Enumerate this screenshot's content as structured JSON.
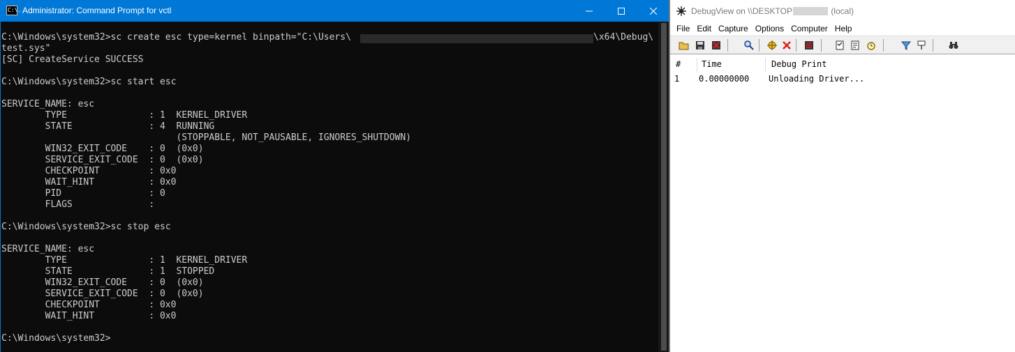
{
  "cmd_window": {
    "title": "Administrator: Command Prompt for vctl",
    "icon_label": "C:\\.",
    "lines": [
      "C:\\Windows\\system32>sc create esc type=kernel binpath=\"C:\\Users\\",
      "test.sys\"",
      "[SC] CreateService SUCCESS",
      "",
      "C:\\Windows\\system32>sc start esc",
      "",
      "SERVICE_NAME: esc",
      "        TYPE               : 1  KERNEL_DRIVER",
      "        STATE              : 4  RUNNING",
      "                                (STOPPABLE, NOT_PAUSABLE, IGNORES_SHUTDOWN)",
      "        WIN32_EXIT_CODE    : 0  (0x0)",
      "        SERVICE_EXIT_CODE  : 0  (0x0)",
      "        CHECKPOINT         : 0x0",
      "        WAIT_HINT          : 0x0",
      "        PID                : 0",
      "        FLAGS              :",
      "",
      "C:\\Windows\\system32>sc stop esc",
      "",
      "SERVICE_NAME: esc",
      "        TYPE               : 1  KERNEL_DRIVER",
      "        STATE              : 1  STOPPED",
      "        WIN32_EXIT_CODE    : 0  (0x0)",
      "        SERVICE_EXIT_CODE  : 0  (0x0)",
      "        CHECKPOINT         : 0x0",
      "        WAIT_HINT          : 0x0",
      "",
      "C:\\Windows\\system32>"
    ],
    "first_line_tail": "\\x64\\Debug\\"
  },
  "debugview_window": {
    "title_prefix": "DebugView on \\\\DESKTOP",
    "title_suffix": "(local)",
    "menu": [
      "File",
      "Edit",
      "Capture",
      "Options",
      "Computer",
      "Help"
    ],
    "toolbar_icons": [
      "open-icon",
      "save-icon",
      "clear-icon",
      "find-icon",
      "capture-icon",
      "autoscroll-icon",
      "clock-time-icon",
      "properties-icon",
      "highlight-icon",
      "history-icon",
      "filter-icon",
      "pin-icon",
      "binoculars-icon"
    ],
    "columns": [
      "#",
      "Time",
      "Debug Print"
    ],
    "rows": [
      {
        "index": "1",
        "time": "0.00000000",
        "message": "Unloading Driver..."
      }
    ]
  },
  "colors": {
    "cmd_titlebar": "#0078d7",
    "cmd_background": "#0c0c0c",
    "cmd_text": "#cccccc",
    "debugview_background": "#ffffff"
  }
}
